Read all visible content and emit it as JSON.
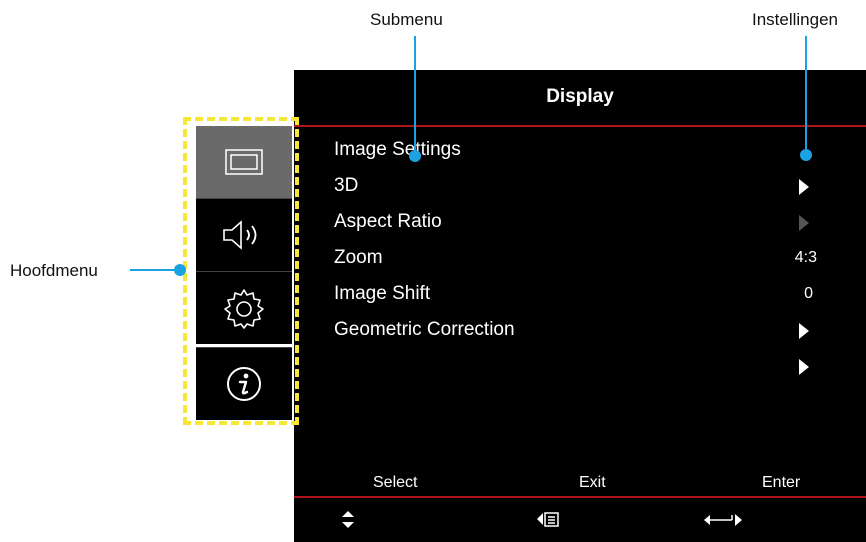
{
  "callouts": {
    "submenu": "Submenu",
    "instellingen": "Instellingen",
    "hoofdmenu": "Hoofdmenu"
  },
  "osd": {
    "title": "Display",
    "items": [
      {
        "label": "Image Settings",
        "value": "",
        "indicator": "none"
      },
      {
        "label": "3D",
        "value": "",
        "indicator": "arrow"
      },
      {
        "label": "Aspect Ratio",
        "value": "",
        "indicator": "arrow-dim"
      },
      {
        "label": "Zoom",
        "value": "4:3",
        "indicator": "value"
      },
      {
        "label": "Image Shift",
        "value": "0",
        "indicator": "value"
      },
      {
        "label": "Geometric Correction",
        "value": "",
        "indicator": "arrow"
      }
    ],
    "footer": {
      "select": "Select",
      "exit": "Exit",
      "enter": "Enter"
    }
  },
  "main_menu": {
    "icons": [
      "display-icon",
      "audio-icon",
      "settings-icon",
      "info-icon"
    ],
    "active": "display-icon"
  },
  "colors": {
    "accent": "#1aa3e0",
    "highlight": "#f5e63a",
    "divider": "#b0141b",
    "active_tile": "#6a6a6a"
  }
}
